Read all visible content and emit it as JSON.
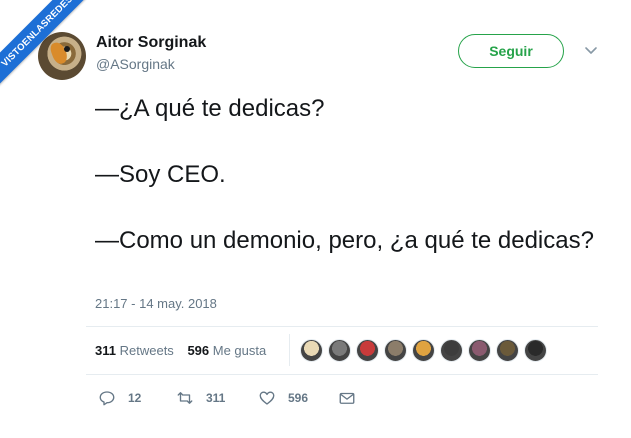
{
  "watermark": {
    "text": "VISTOENLASREDES"
  },
  "user": {
    "name": "Aitor Sorginak",
    "handle": "@ASorginak"
  },
  "follow_label": "Seguir",
  "tweet": {
    "lines": [
      "—¿A qué te dedicas?",
      "—Soy CEO.",
      "—Como un demonio, pero, ¿a qué te dedicas?"
    ],
    "timestamp": "21:17 - 14 may. 2018"
  },
  "stats": {
    "retweets_count": "311",
    "retweets_label": "Retweets",
    "likes_count": "596",
    "likes_label": "Me gusta"
  },
  "likers": [
    {
      "icon": "liker-avatar",
      "color": "#e9d9b5"
    },
    {
      "icon": "liker-avatar",
      "color": "#7a7a7a"
    },
    {
      "icon": "liker-avatar",
      "color": "#c93b3b"
    },
    {
      "icon": "liker-avatar",
      "color": "#8c7d6a"
    },
    {
      "icon": "liker-avatar",
      "color": "#e0a340"
    },
    {
      "icon": "liker-avatar",
      "color": "#3d3d3d"
    },
    {
      "icon": "liker-avatar",
      "color": "#8a5a6f"
    },
    {
      "icon": "liker-avatar",
      "color": "#6b5a3a"
    },
    {
      "icon": "liker-avatar",
      "color": "#2a2a2a"
    }
  ],
  "actions": {
    "reply_count": "12",
    "retweet_count": "311",
    "like_count": "596"
  },
  "colors": {
    "follow_accent": "#26a34a",
    "secondary_text": "#657786",
    "ribbon": "#1d6fd6"
  }
}
